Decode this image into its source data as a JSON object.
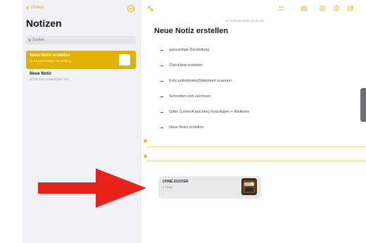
{
  "sidebar": {
    "back_label": "Ordner",
    "title": "Notizen",
    "search_placeholder": "Suchen",
    "notes": [
      {
        "title": "Neue Notiz erstellen",
        "subtitle": "21:15  ganzseitige Darstellung"
      },
      {
        "title": "Neue Notiz",
        "subtitle": "20:59  Kein zusätzlicher Text"
      }
    ]
  },
  "toolbar_icons": [
    "expand-icon",
    "checklist-icon",
    "camera-icon",
    "markup-icon",
    "more-icon",
    "compose-icon"
  ],
  "note": {
    "date": "21. Februar 2022 um 21:15",
    "title": "Neue Notiz erstellen",
    "items": [
      "ganzseitige Darstellung",
      "Checkliste erstellen",
      "Foto aufnehmen/Dokument scannen",
      "Schreiben und zeichnen",
      "Gitter (Linien/Kästchen) hinzufügen + Weiteres",
      "Neue Notiz erstellen"
    ],
    "attachment": {
      "title": "OHNE ZUCKER",
      "subtitle": "1 Scan"
    }
  },
  "colors": {
    "accent": "#e1b000",
    "arrow": "#e8241a"
  }
}
